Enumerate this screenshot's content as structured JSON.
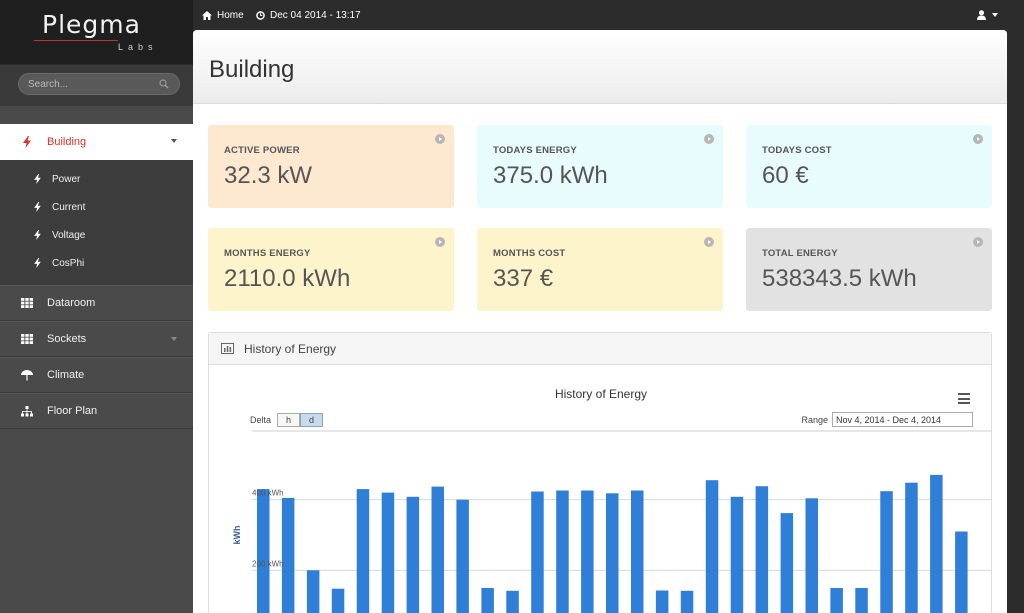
{
  "app": {
    "logo": "Plegma",
    "logo_sub": "Labs"
  },
  "search": {
    "placeholder": "Search..."
  },
  "topbar": {
    "home_label": "Home",
    "datetime": "Dec 04 2014 - 13:17"
  },
  "sidebar": {
    "items": [
      {
        "label": "Building",
        "icon": "bolt-icon",
        "active": true
      },
      {
        "label": "Dataroom",
        "icon": "grid-icon"
      },
      {
        "label": "Sockets",
        "icon": "grid-icon"
      },
      {
        "label": "Climate",
        "icon": "umbrella-icon"
      },
      {
        "label": "Floor Plan",
        "icon": "sitemap-icon"
      }
    ],
    "subitems": [
      {
        "label": "Power"
      },
      {
        "label": "Current"
      },
      {
        "label": "Voltage"
      },
      {
        "label": "CosPhi"
      }
    ]
  },
  "page": {
    "title": "Building"
  },
  "cards": [
    {
      "label": "ACTIVE POWER",
      "value": "32.3 kW",
      "color": "#fde9cf"
    },
    {
      "label": "TODAYS ENERGY",
      "value": "375.0 kWh",
      "color": "#e8fbfd"
    },
    {
      "label": "TODAYS COST",
      "value": "60 €",
      "color": "#e8fbfd"
    },
    {
      "label": "MONTHS ENERGY",
      "value": "2110.0 kWh",
      "color": "#fdf4cc"
    },
    {
      "label": "MONTHS COST",
      "value": "337 €",
      "color": "#fdf4cc"
    },
    {
      "label": "TOTAL ENERGY",
      "value": "538343.5 kWh",
      "color": "#e2e2e2"
    }
  ],
  "panel": {
    "title": "History of Energy"
  },
  "controls": {
    "delta_label": "Delta",
    "delta_options": [
      "h",
      "d"
    ],
    "delta_selected": "d",
    "range_label": "Range",
    "range_value": "Nov 4, 2014 - Dec 4, 2014"
  },
  "chart_data": {
    "type": "bar",
    "title": "History of Energy",
    "ylabel": "kWh",
    "yticks": [
      "200 kWh",
      "400 kWh"
    ],
    "ylim": [
      0,
      600
    ],
    "bar_color": "#2f7ed8",
    "values": [
      430,
      405,
      200,
      148,
      430,
      420,
      408,
      437,
      400,
      150,
      142,
      423,
      426,
      426,
      418,
      426,
      143,
      142,
      455,
      408,
      438,
      362,
      404,
      150,
      150,
      424,
      448,
      470,
      310
    ]
  }
}
